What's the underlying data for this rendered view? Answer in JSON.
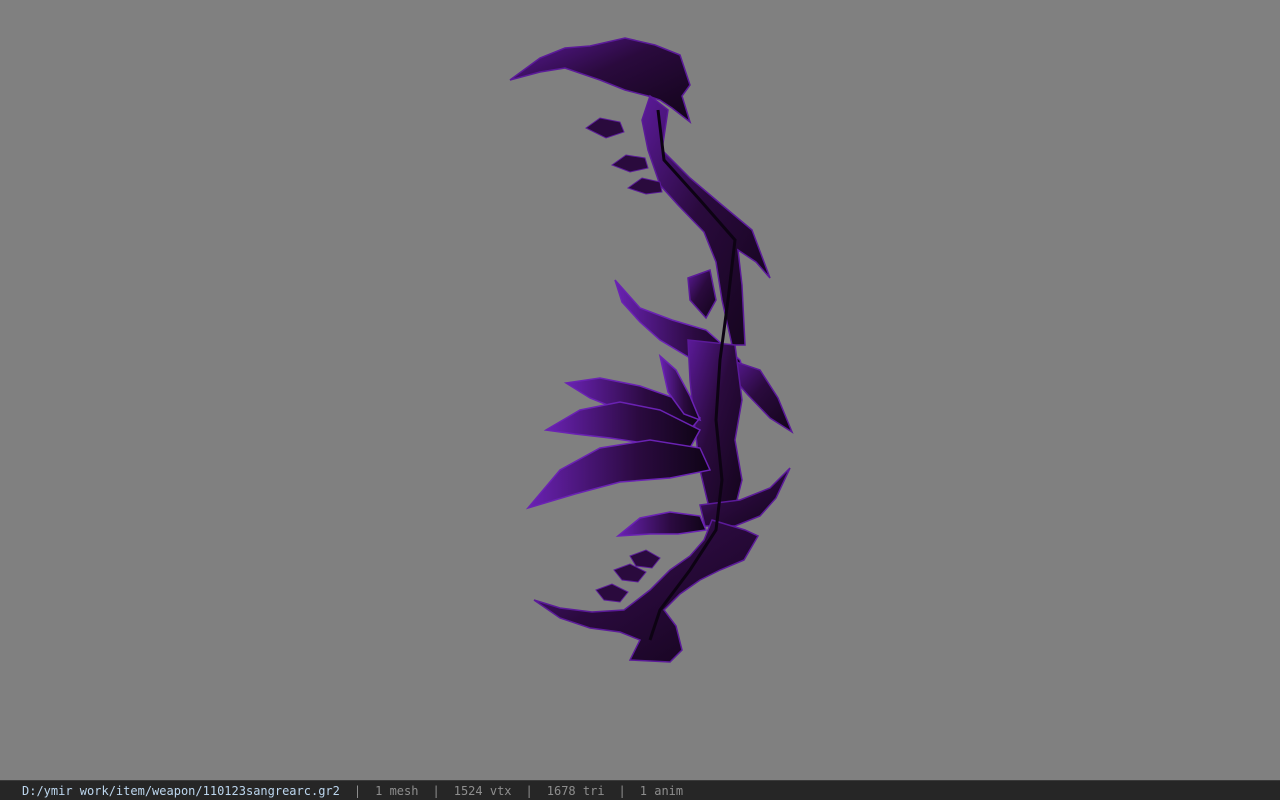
{
  "viewport": {
    "background_color": "#808080",
    "model": {
      "name": "purple-bow-model",
      "base_color": "#2a0a3d",
      "highlight_color": "#5b1a99",
      "dark_color": "#120419"
    }
  },
  "statusbar": {
    "file_path": "D:/ymir work/item/weapon/110123sangrearc.gr2",
    "separator": "|",
    "mesh_count": "1 mesh",
    "vertex_count": "1524 vtx",
    "triangle_count": "1678 tri",
    "anim_count": "1 anim",
    "path_color": "#bcd6ee",
    "text_color": "#8e8e8e"
  }
}
